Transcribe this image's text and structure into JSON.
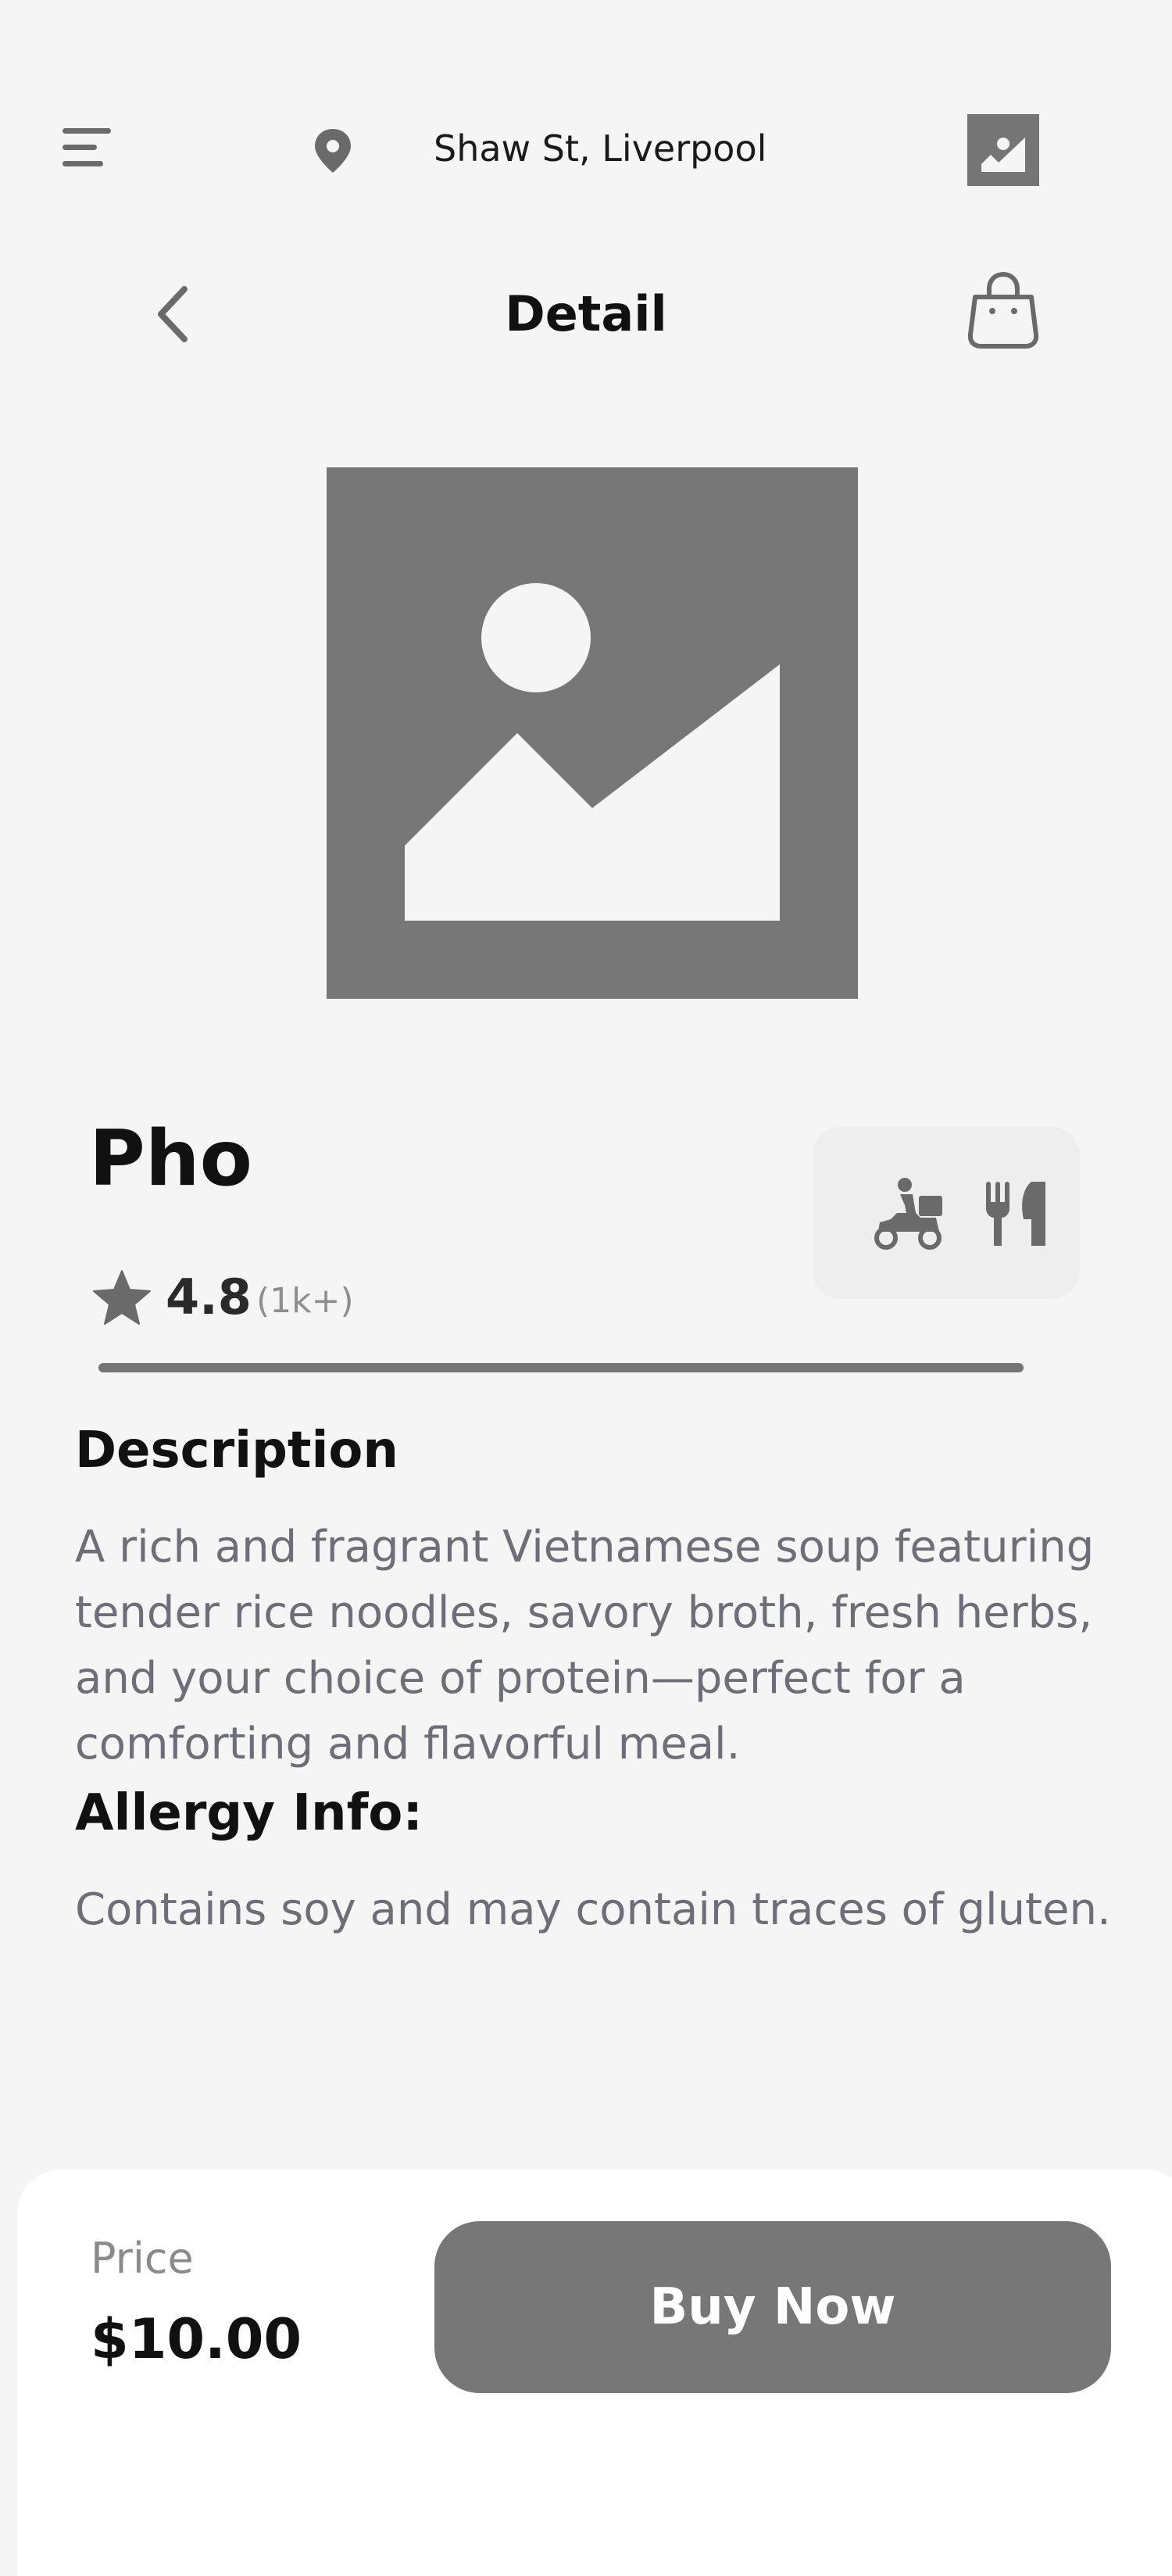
{
  "header": {
    "location": "Shaw St, Liverpool",
    "menu_icon": "hamburger-menu-icon",
    "location_icon": "map-pin-icon",
    "avatar_icon": "image-placeholder-icon"
  },
  "nav": {
    "title": "Detail",
    "back_icon": "chevron-left-icon",
    "cart_icon": "shopping-bag-icon"
  },
  "product": {
    "name": "Pho",
    "rating": "4.8",
    "rating_count": "(1k+)",
    "image_icon": "image-placeholder-icon",
    "services": [
      "delivery-scooter-icon",
      "fork-knife-icon"
    ]
  },
  "description": {
    "heading": "Description",
    "text": "A rich and fragrant Vietnamese soup featuring tender rice noodles, savory broth, fresh herbs, and your choice of protein—perfect for a comforting and flavorful meal."
  },
  "allergy": {
    "heading": "Allergy Info:",
    "text": "Contains soy and may contain traces of gluten."
  },
  "checkout": {
    "price_label": "Price",
    "price": "$10.00",
    "buy_label": "Buy Now"
  },
  "colors": {
    "background": "#f5f5f5",
    "placeholder_gray": "#777777",
    "text_primary": "#111111",
    "text_secondary": "#6e6e78",
    "surface": "#ffffff"
  }
}
